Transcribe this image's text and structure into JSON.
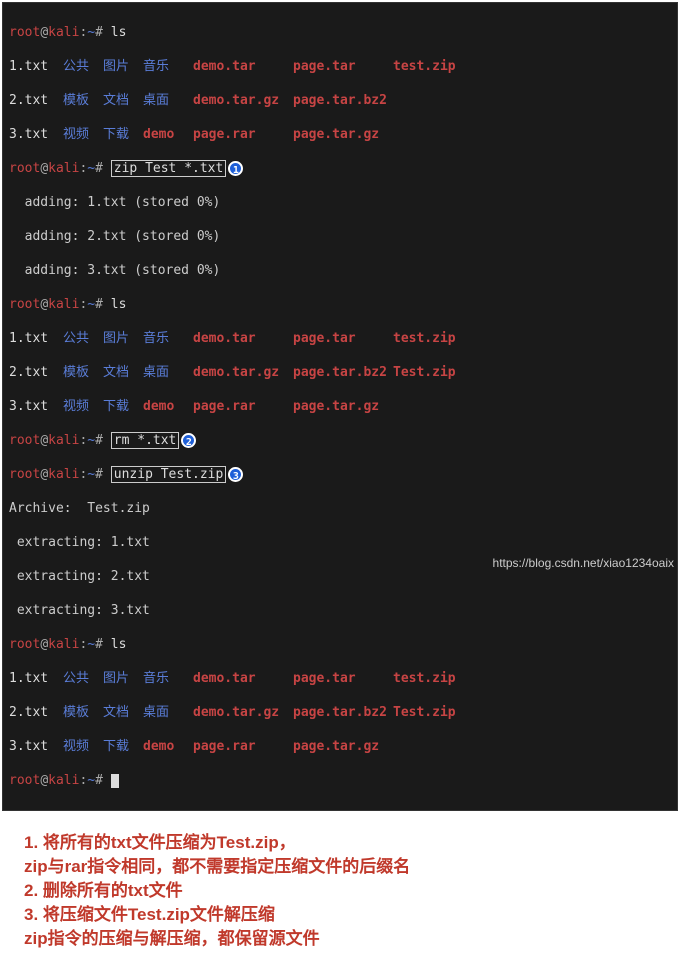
{
  "prompt": {
    "user": "root",
    "host": "kali",
    "path": "~",
    "sym": "#"
  },
  "cmds": {
    "ls": "ls",
    "zip": "zip Test *.txt",
    "rm": "rm *.txt",
    "unzip": "unzip Test.zip"
  },
  "markers": {
    "m1": "1",
    "m2": "2",
    "m3": "3"
  },
  "ls1": {
    "r1": [
      "1.txt",
      "公共",
      "图片",
      "音乐",
      "demo.tar",
      "page.tar",
      "test.zip"
    ],
    "r2": [
      "2.txt",
      "模板",
      "文档",
      "桌面",
      "demo.tar.gz",
      "page.tar.bz2",
      ""
    ],
    "r3": [
      "3.txt",
      "视频",
      "下载",
      "demo",
      "page.rar",
      "page.tar.gz",
      ""
    ]
  },
  "zipout": [
    "  adding: 1.txt (stored 0%)",
    "  adding: 2.txt (stored 0%)",
    "  adding: 3.txt (stored 0%)"
  ],
  "ls2": {
    "r1": [
      "1.txt",
      "公共",
      "图片",
      "音乐",
      "demo.tar",
      "page.tar",
      "test.zip"
    ],
    "r2": [
      "2.txt",
      "模板",
      "文档",
      "桌面",
      "demo.tar.gz",
      "page.tar.bz2",
      "Test.zip"
    ],
    "r3": [
      "3.txt",
      "视频",
      "下载",
      "demo",
      "page.rar",
      "page.tar.gz",
      ""
    ]
  },
  "unzipout": [
    "Archive:  Test.zip",
    " extracting: 1.txt",
    " extracting: 2.txt",
    " extracting: 3.txt"
  ],
  "ls3": {
    "r1": [
      "1.txt",
      "公共",
      "图片",
      "音乐",
      "demo.tar",
      "page.tar",
      "test.zip"
    ],
    "r2": [
      "2.txt",
      "模板",
      "文档",
      "桌面",
      "demo.tar.gz",
      "page.tar.bz2",
      "Test.zip"
    ],
    "r3": [
      "3.txt",
      "视频",
      "下载",
      "demo",
      "page.rar",
      "page.tar.gz",
      ""
    ]
  },
  "notes": {
    "n1a": "1. 将所有的txt文件压缩为Test.zip，",
    "n1b": "    zip与rar指令相同，都不需要指定压缩文件的后缀名",
    "n2": "2. 删除所有的txt文件",
    "n3a": "3. 将压缩文件Test.zip文件解压缩",
    "n3b": "    zip指令的压缩与解压缩，都保留源文件"
  },
  "watermark": "https://blog.csdn.net/xiao1234oaix"
}
